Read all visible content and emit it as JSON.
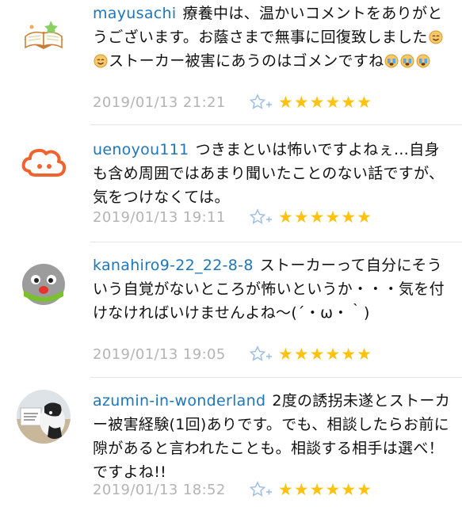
{
  "comments": [
    {
      "username": "mayusachi",
      "text_before_emoji": "療養中は、温かいコメントをありがとうございます。お蔭さまで無事に回復致しました",
      "text_middle": "ストーカー被害にあうのはゴメンですね",
      "timestamp": "2019/01/13 21:21",
      "stars": "★★★★★★",
      "avatar_icon": "open-book-icon"
    },
    {
      "username": "uenoyou111",
      "text": "つきまといは怖いですよねぇ…自身も含め周囲ではあまり聞いたことのない話ですが、気をつけなくては。",
      "timestamp": "2019/01/13 19:11",
      "stars": "★★★★★★",
      "avatar_icon": "orange-cloud-face-icon"
    },
    {
      "username": "kanahiro9-22_22-8-8",
      "text": "ストーカーって自分にそういう自覚がないところが怖いというか・・・気を付けなければいけませんよね～(´・ω・｀)",
      "timestamp": "2019/01/13 19:05",
      "stars": "★★★★★★",
      "avatar_icon": "gray-bird-face-icon"
    },
    {
      "username": "azumin-in-wonderland",
      "text": "2度の誘拐未遂とストーカー被害経験(1回)ありです。でも、相談したらお前に隙があると言われたことも。相談する相手は選べ！ですよね!!",
      "timestamp": "2019/01/13 18:52",
      "stars": "★★★★★★",
      "avatar_icon": "cow-photo-avatar"
    }
  ],
  "colors": {
    "username": "#1f76b8",
    "timestamp": "#b4b4b4",
    "star": "#ffc20f",
    "star_add": "#9fbfe0"
  }
}
